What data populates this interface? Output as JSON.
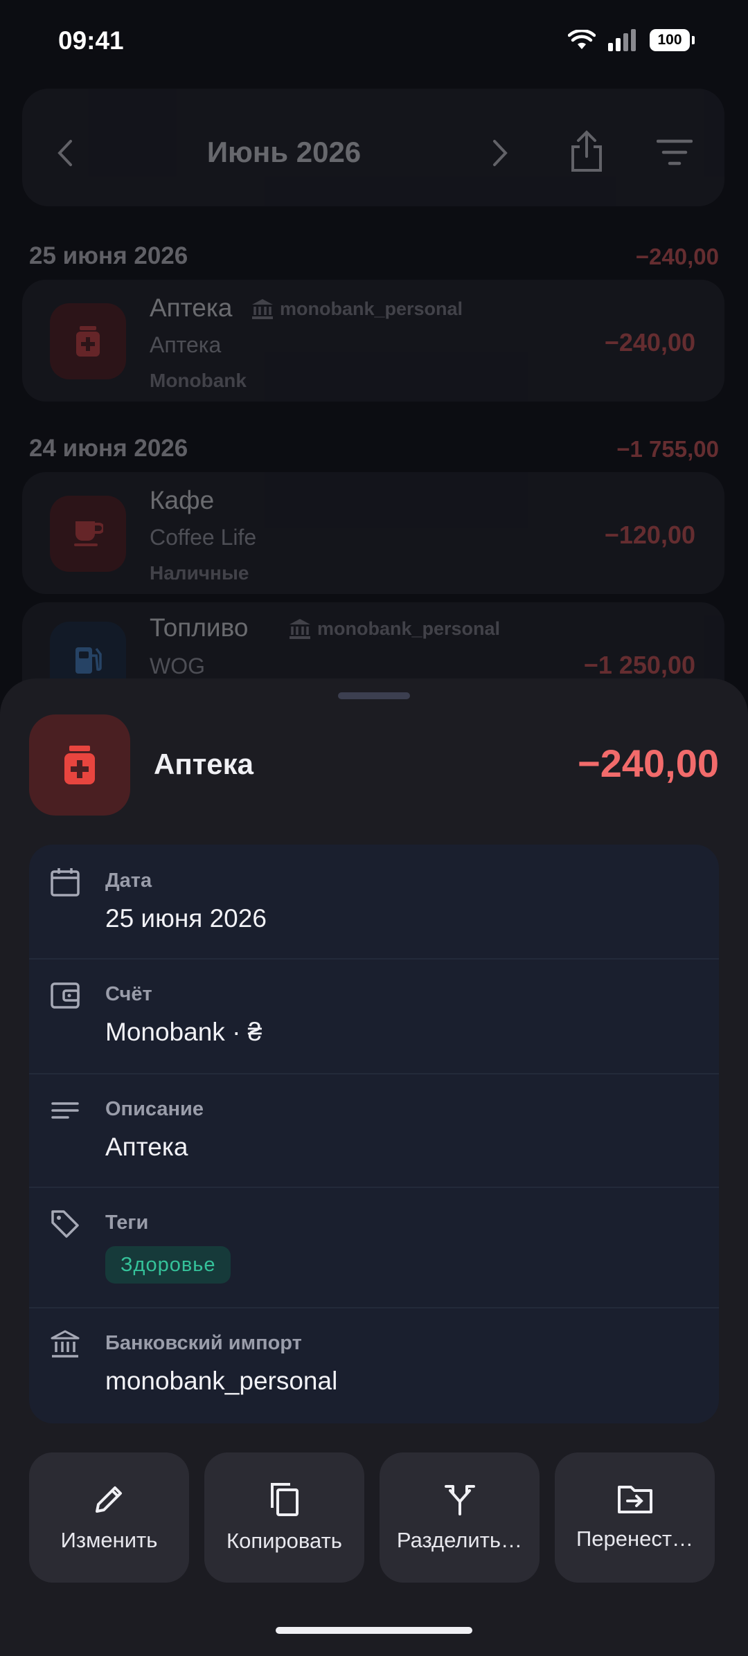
{
  "status": {
    "time": "09:41",
    "battery": "100"
  },
  "header": {
    "month": "Июнь 2026"
  },
  "list": {
    "groups": [
      {
        "date": "25 июня 2026",
        "total": "−240,00"
      },
      {
        "date": "24 июня 2026",
        "total": "−1 755,00"
      }
    ],
    "items": [
      {
        "category": "Аптека",
        "bank": "monobank_personal",
        "description": "Аптека",
        "account": "Monobank",
        "amount": "−240,00",
        "icon": "medicine-icon"
      },
      {
        "category": "Кафе",
        "description": "Coffee Life",
        "account": "Наличные",
        "amount": "−120,00",
        "icon": "cup-icon"
      },
      {
        "category": "Топливо",
        "bank": "monobank_personal",
        "description": "WOG",
        "amount": "−1 250,00",
        "icon": "fuel-icon"
      }
    ]
  },
  "sheet": {
    "title": "Аптека",
    "amount": "−240,00",
    "details": [
      {
        "label": "Дата",
        "value": "25 июня 2026",
        "icon": "calendar-icon"
      },
      {
        "label": "Счёт",
        "value": "Monobank · ₴",
        "icon": "wallet-icon"
      },
      {
        "label": "Описание",
        "value": "Аптека",
        "icon": "notes-icon"
      },
      {
        "label": "Теги",
        "tag": "Здоровье",
        "icon": "tag-icon"
      },
      {
        "label": "Банковский импорт",
        "value": "monobank_personal",
        "icon": "bank-icon"
      }
    ],
    "actions": [
      {
        "label": "Изменить",
        "icon": "pencil-icon"
      },
      {
        "label": "Копировать",
        "icon": "copy-icon"
      },
      {
        "label": "Разделить…",
        "icon": "split-icon"
      },
      {
        "label": "Перенест…",
        "icon": "move-folder-icon"
      }
    ]
  },
  "colors": {
    "accent_red": "#f26b6b",
    "tag_green": "#35c29a",
    "sheet_bg": "#1c1c22",
    "card_bg": "#1a1f2e"
  }
}
